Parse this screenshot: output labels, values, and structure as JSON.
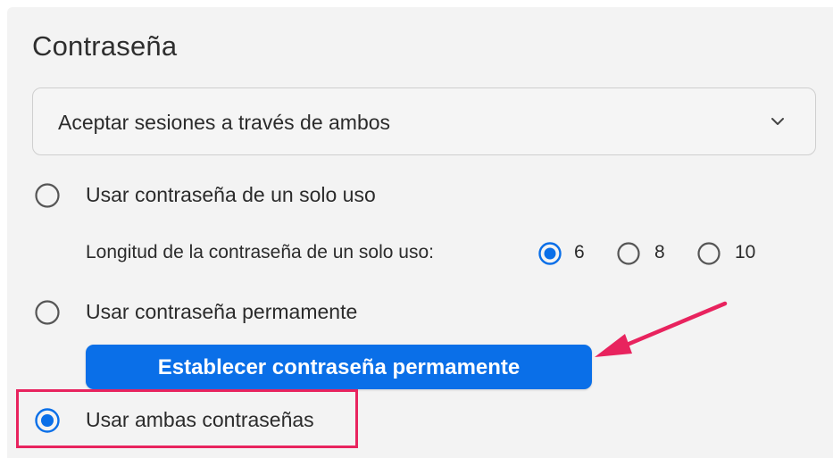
{
  "section": {
    "title": "Contraseña"
  },
  "session_select": {
    "value": "Aceptar sesiones a través de ambos",
    "icon": "chevron-down-icon"
  },
  "options": {
    "one_time": {
      "label": "Usar contraseña de un solo uso",
      "selected": false
    },
    "length": {
      "label": "Longitud de la contraseña de un solo uso:",
      "choices": [
        {
          "label": "6",
          "selected": true
        },
        {
          "label": "8",
          "selected": false
        },
        {
          "label": "10",
          "selected": false
        }
      ]
    },
    "permanent": {
      "label": "Usar contraseña permamente",
      "selected": false
    },
    "set_permanent_button": {
      "label": "Establecer contraseña permamente"
    },
    "both": {
      "label": "Usar ambas contraseñas",
      "selected": true
    }
  },
  "colors": {
    "accent": "#0a6fe8",
    "annotation": "#e8235e",
    "panel_bg": "#f3f3f3"
  }
}
